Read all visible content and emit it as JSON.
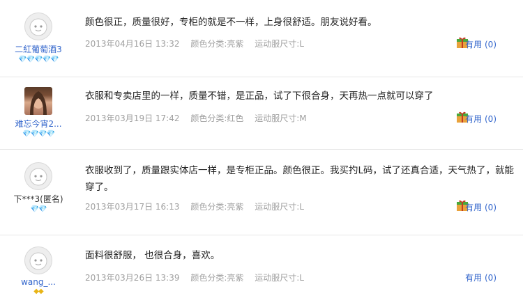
{
  "reviews": [
    {
      "username": "二紅葡萄酒3",
      "badge": "💎💎💎💎💎",
      "avatar": "default-avatar-icon",
      "content": "颜色很正，质量很好，专柜的就是不一样，上身很舒适。朋友说好看。",
      "date": "2013年04月16日 13:32",
      "color": "颜色分类:亮紫",
      "size": "运动服尺寸:L",
      "useful_label": "有用",
      "useful_count": "(0)"
    },
    {
      "username": "难忘今宵2...",
      "badge": "💎💎💎💎",
      "avatar": "photo-avatar",
      "content": "衣服和专卖店里的一样，质量不错，是正品，试了下很合身，天再热一点就可以穿了",
      "date": "2013年03月19日 17:42",
      "color": "颜色分类:红色",
      "size": "运动服尺寸:M",
      "useful_label": "有用",
      "useful_count": "(0)"
    },
    {
      "username": "下***3(匿名)",
      "badge": "💎💎",
      "avatar": "default-avatar-icon",
      "content": "衣服收到了，质量跟实体店一样，是专柜正品。颜色很正。我买扚L码，试了还真合适，天气热了，就能穿了。",
      "date": "2013年03月17日 16:13",
      "color": "颜色分类:亮紫",
      "size": "运动服尺寸:L",
      "useful_label": "有用",
      "useful_count": "(0)"
    },
    {
      "username": "wang_...",
      "badge": "◆◆",
      "avatar": "default-avatar-icon",
      "content": "面料很舒服， 也很合身，喜欢。",
      "date": "2013年03月26日 13:39",
      "color": "颜色分类:亮紫",
      "size": "运动服尺寸:L",
      "useful_label": "有用",
      "useful_count": "(0)"
    }
  ],
  "colors": {
    "link": "#3366cc",
    "meta": "#a0a0a0",
    "badge_red": "#d0223b",
    "badge_gold": "#e8b416"
  }
}
